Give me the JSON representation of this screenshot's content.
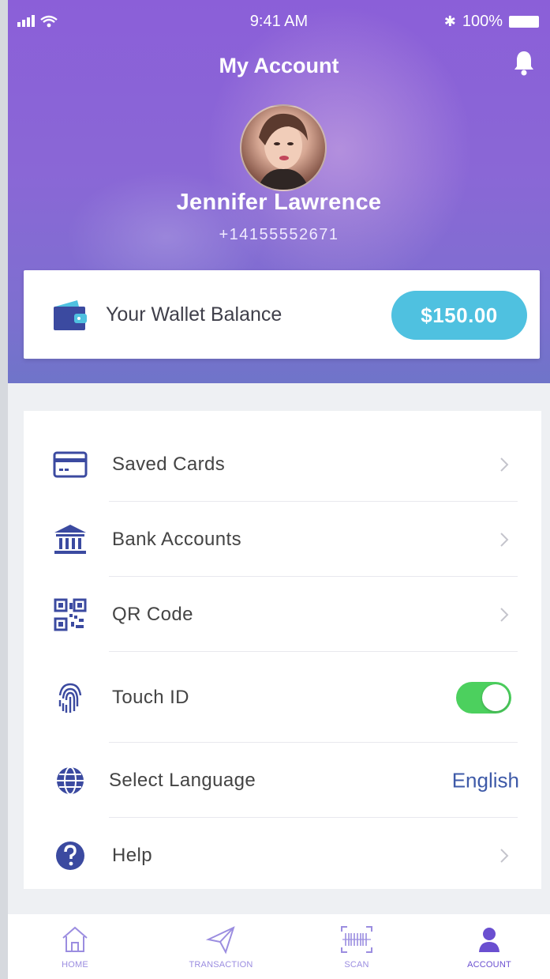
{
  "status_bar": {
    "time": "9:41 AM",
    "battery": "100%"
  },
  "header": {
    "title": "My Account"
  },
  "profile": {
    "name": "Jennifer Lawrence",
    "phone": "+14155552671"
  },
  "wallet": {
    "label": "Your Wallet Balance",
    "amount": "$150.00"
  },
  "menu": {
    "items": [
      {
        "label": "Saved Cards",
        "icon": "credit-card-icon"
      },
      {
        "label": "Bank Accounts",
        "icon": "bank-icon"
      },
      {
        "label": "QR Code",
        "icon": "qr-code-icon"
      },
      {
        "label": "Touch ID",
        "icon": "fingerprint-icon",
        "toggle": true
      },
      {
        "label": "Select Language",
        "icon": "globe-icon",
        "value": "English"
      },
      {
        "label": "Help",
        "icon": "help-icon"
      }
    ]
  },
  "tabbar": {
    "tabs": [
      {
        "label": "HOME",
        "icon": "home-icon"
      },
      {
        "label": "TRANSACTION",
        "icon": "send-icon"
      },
      {
        "label": "SCAN",
        "icon": "scan-icon"
      },
      {
        "label": "ACCOUNT",
        "icon": "user-icon",
        "active": true
      }
    ]
  },
  "colors": {
    "primary": "#8a63d6",
    "accent": "#4fc1e0",
    "toggle_on": "#4cd05e",
    "icon": "#3b4aa0"
  }
}
